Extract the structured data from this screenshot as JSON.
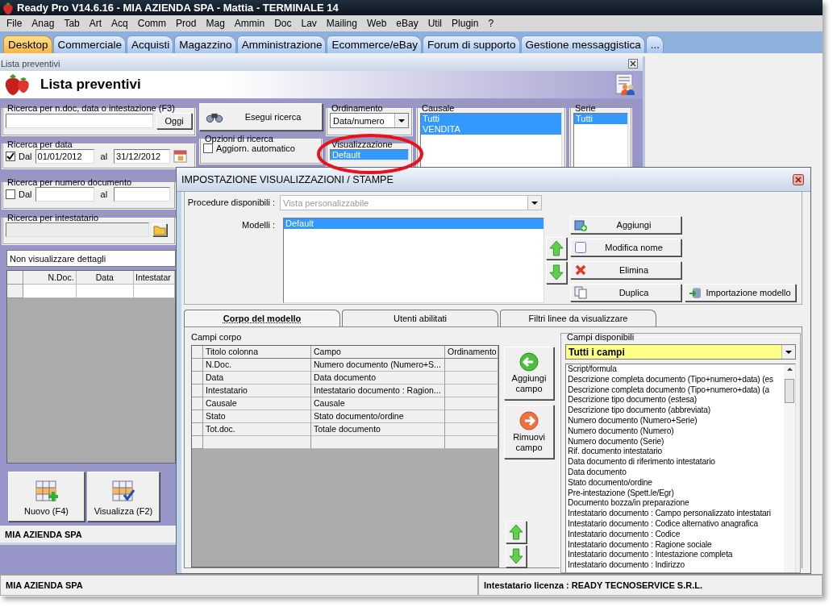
{
  "window": {
    "title": "Ready Pro V14.6.16 - MIA AZIENDA SPA - Mattia - TERMINALE 14"
  },
  "menu": [
    "File",
    "Anag",
    "Tab",
    "Art",
    "Acq",
    "Comm",
    "Prod",
    "Mag",
    "Ammin",
    "Doc",
    "Lav",
    "Mailing",
    "Web",
    "eBay",
    "Util",
    "Plugin",
    "?"
  ],
  "tabs": [
    {
      "label": "Desktop",
      "selected": true
    },
    {
      "label": "Commerciale",
      "selected": false
    },
    {
      "label": "Acquisti",
      "selected": false
    },
    {
      "label": "Magazzino",
      "selected": false
    },
    {
      "label": "Amministrazione",
      "selected": false
    },
    {
      "label": "Ecommerce/eBay",
      "selected": false
    },
    {
      "label": "Forum di supporto",
      "selected": false
    },
    {
      "label": "Gestione messaggistica",
      "selected": false
    },
    {
      "label": "...",
      "selected": false
    }
  ],
  "list_window": {
    "caption": "Lista preventivi",
    "title": "Lista preventivi",
    "search": {
      "legend": "Ricerca per n.doc, data o intestazione (F3)",
      "button": "Oggi"
    },
    "date_search": {
      "legend": "Ricerca per data",
      "checked": true,
      "from_label": "Dal",
      "from": "01/01/2012",
      "to_label": "al",
      "to": "31/12/2012"
    },
    "run_button": "Esegui ricerca",
    "options": {
      "legend": "Opzioni di ricerca",
      "label": "Aggiorn. automatico",
      "checked": false
    },
    "sorting": {
      "legend": "Ordinamento",
      "value": "Data/numero"
    },
    "view": {
      "legend": "Visualizzazione",
      "items": [
        {
          "label": "Default",
          "selected": true
        }
      ]
    },
    "causale": {
      "legend": "Causale",
      "items": [
        {
          "label": "Tutti",
          "selected": true
        },
        {
          "label": "VENDITA",
          "selected": true
        }
      ]
    },
    "serie": {
      "legend": "Serie",
      "items": [
        {
          "label": "Tutti",
          "selected": true
        }
      ]
    },
    "number_search": {
      "legend": "Ricerca per numero documento",
      "checked": false,
      "from_label": "Dal",
      "to_label": "al"
    },
    "holder_search": {
      "legend": "Ricerca per intestatario"
    },
    "detail_mode": "Non visualizzare dettagli",
    "table": {
      "columns": [
        "N.Doc.",
        "Data",
        "Intestatar"
      ]
    },
    "buttons": [
      {
        "label": "Nuovo (F4)",
        "kind": "new"
      },
      {
        "label": "Visualizza (F2)",
        "kind": "view"
      }
    ],
    "company": "MIA AZIENDA SPA"
  },
  "dialog": {
    "title": "IMPOSTAZIONE VISUALIZZAZIONI / STAMPE",
    "procedure": {
      "label": "Procedure disponibili :",
      "value": "Vista personalizzabile",
      "disabled": true
    },
    "models_label": "Modelli :",
    "models": [
      {
        "label": "Default",
        "selected": true
      }
    ],
    "model_buttons": [
      {
        "label": "Aggiungi",
        "kind": "add"
      },
      {
        "label": "Modifica nome",
        "kind": "rename"
      },
      {
        "label": "Elimina",
        "kind": "delete"
      },
      {
        "label": "Duplica",
        "kind": "duplicate"
      }
    ],
    "import_button": "Importazione modello",
    "tabs": [
      {
        "label": "Corpo del modello",
        "selected": true
      },
      {
        "label": "Utenti abilitati",
        "selected": false
      },
      {
        "label": "Filtri linee da visualizzare",
        "selected": false
      }
    ],
    "fields_label": "Campi corpo",
    "grid": {
      "columns": [
        "Titolo colonna",
        "Campo",
        "Ordinamento"
      ],
      "rows": [
        {
          "title": "N.Doc.",
          "field": "Numero documento (Numero+S..."
        },
        {
          "title": "Data",
          "field": "Data documento"
        },
        {
          "title": "Intestatario",
          "field": "Intestatario documento : Ragion..."
        },
        {
          "title": "Causale",
          "field": "Causale"
        },
        {
          "title": "Stato",
          "field": "Stato documento/ordine"
        },
        {
          "title": "Tot.doc.",
          "field": "Totale documento"
        }
      ]
    },
    "add_field": "Aggiungi campo",
    "remove_field": "Rimuovi campo",
    "available": {
      "legend": "Campi disponibili",
      "filter": "Tutti i campi",
      "items": [
        "Script/formula",
        "Descrizione completa documento (Tipo+numero+data) (es",
        "Descrizione completa documento (Tipo+numero+data) (a",
        "Descrizione tipo documento (estesa)",
        "Descrizione tipo documento (abbreviata)",
        "Numero documento (Numero+Serie)",
        "Numero documento (Numero)",
        "Numero documento (Serie)",
        "Rif. documento intestatario",
        "Data documento di riferimento intestatario",
        "Data documento",
        "Stato documento/ordine",
        "Pre-intestazione (Spett.le/Egr)",
        "Documento bozza/in preparazione",
        "Intestatario documento : Campo personalizzato intestatari",
        "Intestatario documento : Codice alternativo anagrafica",
        "Intestatario documento : Codice",
        "Intestatario documento : Ragione sociale",
        "Intestatario documento : Intestazione completa",
        "Intestatario documento : Indirizzo"
      ]
    }
  },
  "status_bar": {
    "company": "MIA AZIENDA SPA",
    "license": "Intestatario licenza : READY TECNOSERVICE S.R.L."
  }
}
